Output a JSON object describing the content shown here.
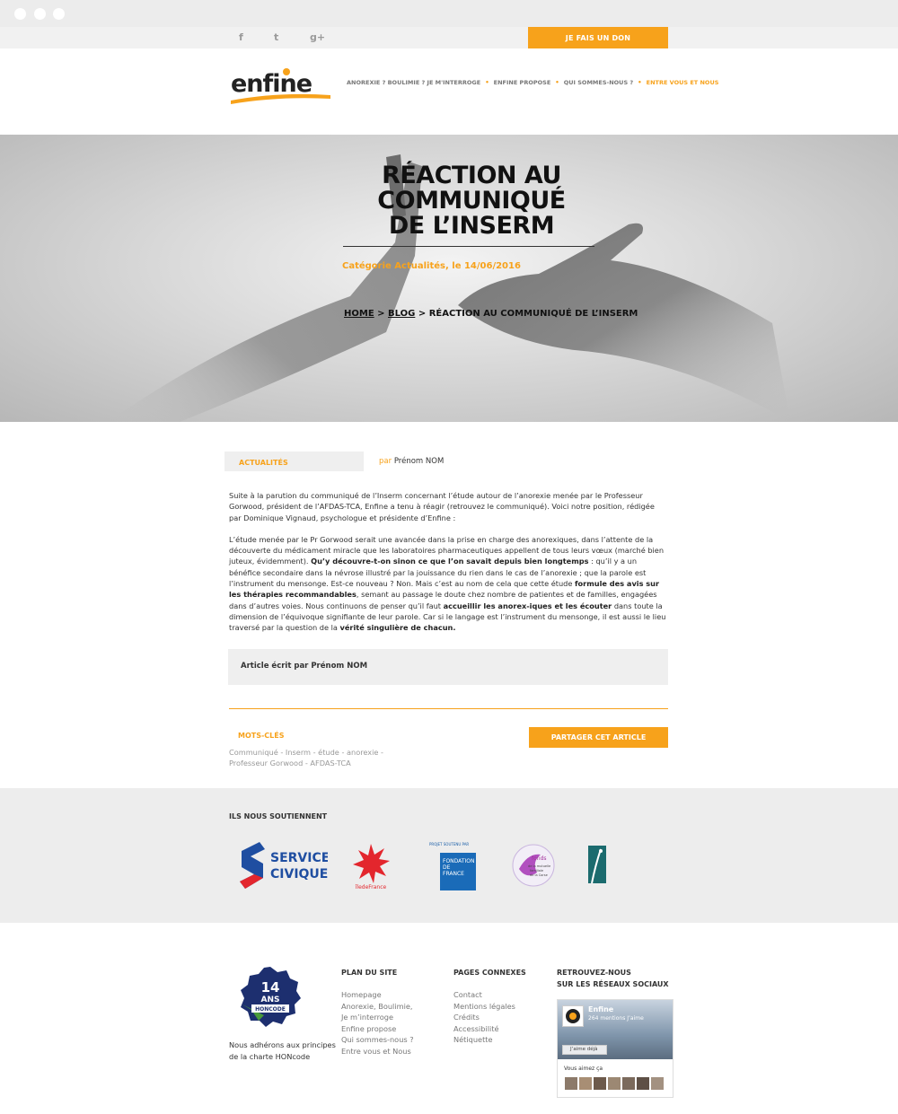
{
  "colors": {
    "accent": "#f7a21b",
    "light_bg": "#efefef"
  },
  "topbar": {
    "social_icons": [
      "facebook-icon",
      "twitter-icon",
      "google-plus-icon"
    ],
    "social_glyphs": {
      "facebook": "f",
      "twitter": "t",
      "gplus": "g+"
    },
    "donate_label": "JE FAIS UN DON"
  },
  "header": {
    "logo_text": "enfine",
    "nav": [
      {
        "label": "ANOREXIE ? BOULIMIE ? JE M'INTERROGE",
        "active": false
      },
      {
        "label": "ENFINE PROPOSE",
        "active": false
      },
      {
        "label": "QUI SOMMES-NOUS ?",
        "active": false
      },
      {
        "label": "ENTRE VOUS ET NOUS",
        "active": true
      }
    ]
  },
  "hero": {
    "title_line1": "RÉACTION AU",
    "title_line2": "COMMUNIQUÉ",
    "title_line3": "DE L’INSERM",
    "meta": "Catégorie Actualités, le 14/06/2016",
    "breadcrumb": {
      "home": "HOME",
      "sep1": " > ",
      "blog": "BLOG",
      "sep2": " > ",
      "current": "RÉACTION AU COMMUNIQUÉ DE L’INSERM"
    }
  },
  "article": {
    "category": "ACTUALITÉS",
    "author_prefix": "par",
    "author": "Prénom NOM",
    "intro": "Suite à la parution du communiqué de l’Inserm concernant l’étude autour de l’anorexie menée par le Professeur Gorwood, président de l’AFDAS-TCA, Enfine a tenu à réagir (retrouvez le communiqué). Voici notre position, rédigée par Dominique Vignaud, psychologue et présidente d’Enfine :",
    "body_1": "L’étude menée par le Pr Gorwood serait une avancée dans la prise en charge des anorexiques, dans l’attente de la découverte du médicament miracle que les laboratoires pharmaceutiques appellent de tous leurs vœux (marché bien juteux, évidemment).",
    "body_bold_1": "Qu’y découvre-t-on sinon ce que l’on savait depuis bien longtemps",
    "body_2": " : qu’il y a un bénéfice secondaire dans la névrose illustré par la jouissance du rien dans le cas de l’anorexie ; que la parole est l’instrument du mensonge. Est-ce nouveau ? Non. Mais c’est au nom de cela que cette étude ",
    "body_bold_2": "formule des avis sur les thérapies recommandables",
    "body_3": ", semant au passage le doute chez nombre de patientes et de familles, engagées dans d’autres voies. Nous continuons de penser qu’il faut ",
    "body_bold_3": "accueillir les anorex-iques et les écouter",
    "body_4": " dans toute la dimension de l’équivoque signifiante de leur parole. Car si le langage est l’instrument du mensonge, il est aussi le lieu traversé par la question de la ",
    "body_bold_4": "vérité singulière de chacun.",
    "written_prefix": "Article écrit par Prénom ",
    "written_name": "NOM",
    "keywords_title": "MOTS-CLÉS",
    "keywords": "Communiqué  - Inserm - étude - anorexie - Professeur Gorwood - AFDAS-TCA",
    "share_label": "PARTAGER CET ARTICLE"
  },
  "supporters": {
    "title": "ILS NOUS SOUTIENNENT",
    "service_civique_1": "SERVICE",
    "service_civique_2": "CIVIQUE",
    "idf_label": "îledeFrance",
    "fondation_small": "PROJET SOUTENU PAR",
    "fondation_1": "FONDATION",
    "fondation_2": "DE",
    "fondation_3": "FRANCE",
    "mutuelle_1": "fonds",
    "mutuelle_2": "de la mutuelle",
    "mutuelle_3": "familiale",
    "mutuelle_4": "de la Corse"
  },
  "footer": {
    "hon_years": "14",
    "hon_ans": "ANS",
    "hon_code": "HONCODE",
    "hon_text": "Nous adhérons aux principes de la charte HONcode",
    "plan_title": "PLAN DU SITE",
    "plan": [
      "Homepage",
      "Anorexie, Boulimie,",
      "Je m’interroge",
      "Enfine propose",
      "Qui sommes-nous ?",
      "Entre vous et Nous"
    ],
    "pages_title": "PAGES CONNEXES",
    "pages": [
      "Contact",
      "Mentions légales",
      "Crédits",
      "Accessibilité",
      "Nétiquette"
    ],
    "social_title_1": "RETROUVEZ-NOUS",
    "social_title_2": "SUR LES RÉSEAUX SOCIAUX",
    "fb_name": "Enfine",
    "fb_count": "264 mentions J’aime",
    "fb_like": "J’aime déjà",
    "fb_friends": "Vous aimez ça"
  }
}
